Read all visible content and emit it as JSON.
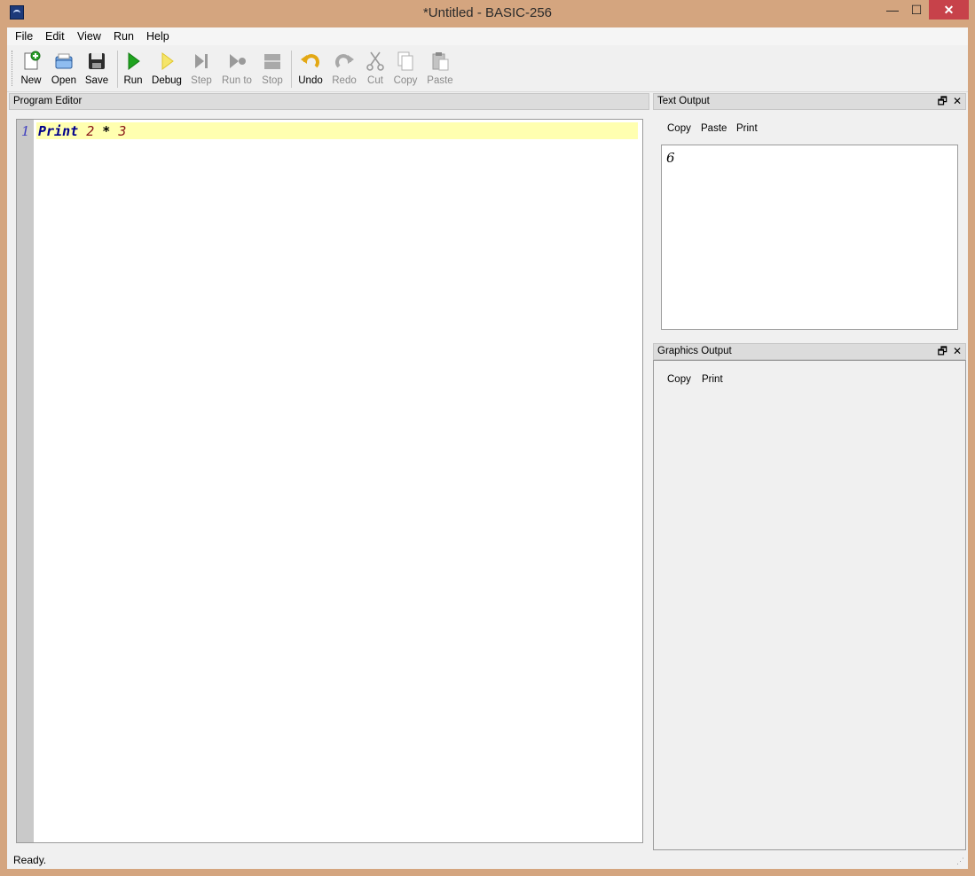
{
  "window": {
    "title": "*Untitled - BASIC-256",
    "min_glyph": "—",
    "max_glyph": "☐",
    "close_glyph": "✕"
  },
  "menu": {
    "items": [
      "File",
      "Edit",
      "View",
      "Run",
      "Help"
    ]
  },
  "toolbar": {
    "new": "New",
    "open": "Open",
    "save": "Save",
    "run": "Run",
    "debug": "Debug",
    "step": "Step",
    "runto": "Run to",
    "stop": "Stop",
    "undo": "Undo",
    "redo": "Redo",
    "cut": "Cut",
    "copy": "Copy",
    "paste": "Paste"
  },
  "editor": {
    "title": "Program Editor",
    "line_number": "1",
    "code": {
      "keyword": "Print",
      "num1": "2",
      "op": "*",
      "num2": "3"
    }
  },
  "text_output": {
    "title": "Text Output",
    "buttons": [
      "Copy",
      "Paste",
      "Print"
    ],
    "value": "6",
    "float_glyph": "🗗",
    "close_glyph": "✕"
  },
  "graphics_output": {
    "title": "Graphics Output",
    "buttons": [
      "Copy",
      "Print"
    ],
    "float_glyph": "🗗",
    "close_glyph": "✕"
  },
  "status": {
    "text": "Ready."
  },
  "icons": {
    "new": "new-file-icon",
    "open": "open-folder-icon",
    "save": "save-disk-icon",
    "run": "play-icon",
    "debug": "debug-icon",
    "step": "step-icon",
    "runto": "run-to-icon",
    "stop": "stop-icon",
    "undo": "undo-icon",
    "redo": "redo-icon",
    "cut": "scissors-icon",
    "copy": "copy-icon",
    "paste": "paste-icon"
  },
  "colors": {
    "titlebar": "#d4a57f",
    "close": "#c7424a",
    "current_line": "#ffffb0",
    "keyword": "#00008b",
    "number": "#8b1a1a",
    "run": "#1fa31f"
  }
}
